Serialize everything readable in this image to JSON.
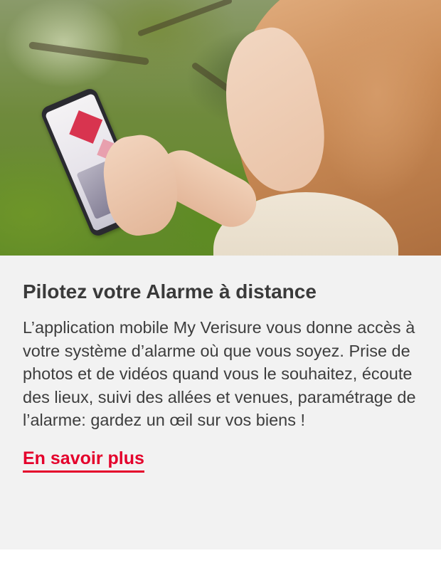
{
  "card": {
    "title": "Pilotez votre Alarme à distance",
    "body": "L’application mobile My Verisure vous donne accès à votre système d’alarme où que vous soyez. Prise de photos et de vidéos quand vous le souhaitez, écoute des lieux, suivi des allées et venues, paramétrage de l’alarme: gardez un œil sur vos biens !",
    "cta_label": "En savoir plus"
  },
  "colors": {
    "accent": "#e4002b",
    "card_background": "#f2f2f2",
    "title_text": "#3a3a3a",
    "body_text": "#3d3d3d"
  },
  "icons": {
    "hero": "photo-woman-holding-smartphone-image"
  }
}
